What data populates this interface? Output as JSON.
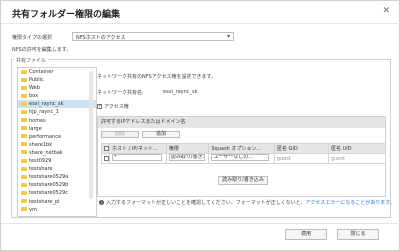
{
  "dialog": {
    "title": "共有フォルダー権限の編集",
    "close_glyph": "✕"
  },
  "perm_type": {
    "label": "権限タイプの選択",
    "selected": "NFSホストのアクセス",
    "hint": "NFSの許可を編集します。"
  },
  "shared_files_legend": "共有ファイル",
  "folders": [
    "Container",
    "Public",
    "Web",
    "box",
    "esxi_raync_sk",
    "hjp_raync_1",
    "homes",
    "large",
    "performance",
    "share1bk",
    "share_netbak",
    "test0929",
    "testshare",
    "testshare0529a",
    "testshare0529b",
    "testshare0529c",
    "testshare_pl",
    "vm"
  ],
  "selected_folder_index": 4,
  "nfs": {
    "description": "ネットワーク共有のNFSアクセス権を設定できます。",
    "network_name_label": "ネットワーク共有名:",
    "network_name_value": "esxi_raync_sk",
    "access_label": "アクセス権",
    "panel_title": "許可するIPアドレスまたはドメイン名",
    "delete_label": "削除",
    "add_label": "追加",
    "columns": [
      "",
      "ホスト / IP/ネット...",
      "権限",
      "Squash オプション...",
      "匿名 GID",
      "匿名 UID"
    ],
    "row": {
      "host": "*",
      "permission": "読み取り/書き...",
      "squash": "ユーザーなしの...",
      "gid": "guest",
      "uid": "guest"
    },
    "rw_button": "読み取り/書き込み"
  },
  "info": {
    "text1": "入力するフォーマットが正しいことを確認してください。フォーマットが正しくないと、",
    "link": "アクセスエラーになることがあります。"
  },
  "footer": {
    "apply": "適用",
    "close": "閉じる"
  }
}
